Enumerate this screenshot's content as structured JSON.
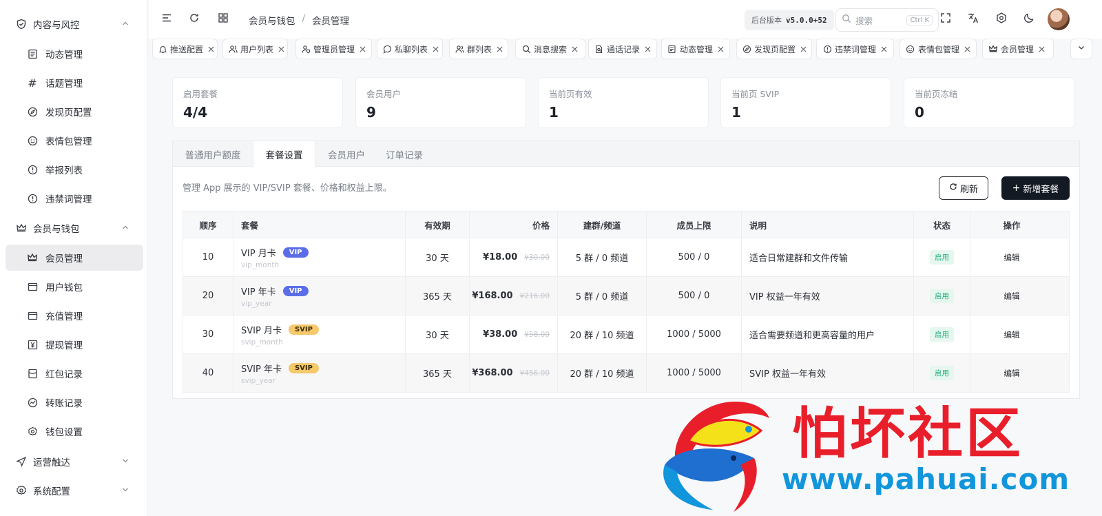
{
  "sidebar": {
    "groups": [
      {
        "label": "内容与风控",
        "icon": "shield-icon"
      },
      {
        "label": "会员与钱包",
        "icon": "crown-icon"
      },
      {
        "label": "运营触达",
        "icon": "send-icon"
      },
      {
        "label": "系统配置",
        "icon": "gear-icon"
      }
    ],
    "content_items": [
      {
        "label": "动态管理",
        "icon": "document-icon"
      },
      {
        "label": "话题管理",
        "icon": "hash-icon"
      },
      {
        "label": "发现页配置",
        "icon": "compass-icon"
      },
      {
        "label": "表情包管理",
        "icon": "smile-icon"
      },
      {
        "label": "举报列表",
        "icon": "alert-icon"
      },
      {
        "label": "违禁词管理",
        "icon": "alert-icon"
      }
    ],
    "member_items": [
      {
        "label": "会员管理",
        "icon": "crown-icon",
        "active": true
      },
      {
        "label": "用户钱包",
        "icon": "wallet-icon"
      },
      {
        "label": "充值管理",
        "icon": "wallet-icon"
      },
      {
        "label": "提现管理",
        "icon": "yen-icon"
      },
      {
        "label": "红包记录",
        "icon": "envelope-icon"
      },
      {
        "label": "转账记录",
        "icon": "transfer-icon"
      },
      {
        "label": "钱包设置",
        "icon": "gear-icon"
      }
    ]
  },
  "header": {
    "breadcrumb": [
      "会员与钱包",
      "会员管理"
    ],
    "version_label": "后台版本",
    "version": "v5.0.0+52",
    "search_placeholder": "搜索",
    "search_shortcut": "Ctrl K"
  },
  "tabs": [
    {
      "label": "推送配置",
      "icon": "bell-icon"
    },
    {
      "label": "用户列表",
      "icon": "users-icon"
    },
    {
      "label": "管理员管理",
      "icon": "user-shield-icon"
    },
    {
      "label": "私聊列表",
      "icon": "chat-icon"
    },
    {
      "label": "群列表",
      "icon": "group-icon"
    },
    {
      "label": "消息搜索",
      "icon": "search-icon"
    },
    {
      "label": "通话记录",
      "icon": "call-log-icon"
    },
    {
      "label": "动态管理",
      "icon": "document-icon"
    },
    {
      "label": "发现页配置",
      "icon": "compass-icon"
    },
    {
      "label": "违禁词管理",
      "icon": "alert-icon"
    },
    {
      "label": "表情包管理",
      "icon": "smile-icon"
    },
    {
      "label": "会员管理",
      "icon": "crown-icon"
    }
  ],
  "stats": [
    {
      "label": "启用套餐",
      "value": "4/4"
    },
    {
      "label": "会员用户",
      "value": "9"
    },
    {
      "label": "当前页有效",
      "value": "1"
    },
    {
      "label": "当前页 SVIP",
      "value": "1"
    },
    {
      "label": "当前页冻结",
      "value": "0"
    }
  ],
  "panel": {
    "tabs": [
      "普通用户额度",
      "套餐设置",
      "会员用户",
      "订单记录"
    ],
    "active_tab": "套餐设置",
    "description": "管理 App 展示的 VIP/SVIP 套餐、价格和权益上限。",
    "refresh_label": "刷新",
    "add_label": "新增套餐"
  },
  "table": {
    "columns": [
      "顺序",
      "套餐",
      "有效期",
      "价格",
      "建群/频道",
      "成员上限",
      "说明",
      "状态",
      "操作"
    ],
    "rows": [
      {
        "seq": "10",
        "name": "VIP 月卡",
        "badge": "VIP",
        "code": "vip_month",
        "duration": "30 天",
        "price": "¥18.00",
        "orig": "¥30.00",
        "group": "5 群 / 0 频道",
        "members": "500 / 0",
        "desc": "适合日常建群和文件传输",
        "status": "启用",
        "op": "编辑"
      },
      {
        "seq": "20",
        "name": "VIP 年卡",
        "badge": "VIP",
        "code": "vip_year",
        "duration": "365 天",
        "price": "¥168.00",
        "orig": "¥216.00",
        "group": "5 群 / 0 频道",
        "members": "500 / 0",
        "desc": "VIP 权益一年有效",
        "status": "启用",
        "op": "编辑"
      },
      {
        "seq": "30",
        "name": "SVIP 月卡",
        "badge": "SVIP",
        "code": "svip_month",
        "duration": "30 天",
        "price": "¥38.00",
        "orig": "¥58.00",
        "group": "20 群 / 10 频道",
        "members": "1000 / 5000",
        "desc": "适合需要频道和更高容量的用户",
        "status": "启用",
        "op": "编辑"
      },
      {
        "seq": "40",
        "name": "SVIP 年卡",
        "badge": "SVIP",
        "code": "svip_year",
        "duration": "365 天",
        "price": "¥368.00",
        "orig": "¥456.00",
        "group": "20 群 / 10 频道",
        "members": "1000 / 5000",
        "desc": "SVIP 权益一年有效",
        "status": "启用",
        "op": "编辑"
      }
    ]
  },
  "watermark": {
    "title": "怕坏社区",
    "url": "www.pahuai.com"
  },
  "colors": {
    "primary_button": "#141a24",
    "vip_badge": "#5b6ee8",
    "svip_badge": "#f5c86a",
    "status_green": "#20b07a",
    "watermark_red": "#e81f2a",
    "watermark_blue": "#1296db"
  }
}
